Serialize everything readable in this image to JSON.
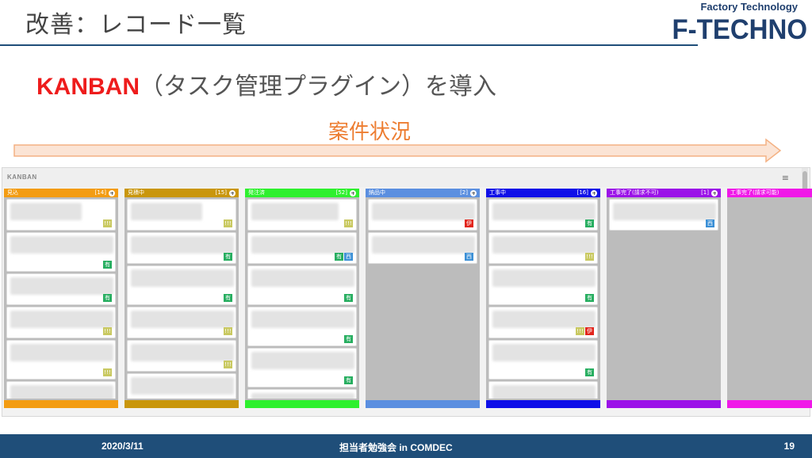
{
  "slide": {
    "title": "改善：レコード一覧",
    "logo_small": "Factory Technology",
    "logo_big": "F-TECHNO",
    "heading_accent": "KANBAN",
    "heading_rest": "（タスク管理プラグイン）を導入",
    "status_label": "案件状況",
    "arrow_color": "#f4b183"
  },
  "kanban": {
    "name": "KANBAN",
    "menu_icon": "hamburger-icon",
    "columns": [
      {
        "label": "見込",
        "count": "[14]",
        "color": "#f39c12",
        "cards": [
          {
            "h": 40,
            "blur": 90,
            "tags": [
              "y"
            ]
          },
          {
            "h": 50,
            "blur": 130,
            "tags": [
              "g"
            ]
          },
          {
            "h": 40,
            "blur": 130,
            "tags": [
              "g"
            ]
          },
          {
            "h": 40,
            "blur": 130,
            "tags": [
              "y"
            ]
          },
          {
            "h": 50,
            "blur": 130,
            "tags": [
              "y"
            ]
          },
          {
            "h": 40,
            "blur": 130,
            "tags": []
          }
        ]
      },
      {
        "label": "見積中",
        "count": "[15]",
        "color": "#c9960c",
        "cards": [
          {
            "h": 40,
            "blur": 90,
            "tags": [
              "y"
            ]
          },
          {
            "h": 40,
            "blur": 130,
            "tags": [
              "g"
            ]
          },
          {
            "h": 50,
            "blur": 130,
            "tags": [
              "g"
            ]
          },
          {
            "h": 40,
            "blur": 130,
            "tags": [
              "y"
            ]
          },
          {
            "h": 40,
            "blur": 130,
            "tags": [
              "y"
            ]
          },
          {
            "h": 40,
            "blur": 130,
            "tags": []
          }
        ]
      },
      {
        "label": "発注済",
        "count": "[52]",
        "color": "#2ef02e",
        "cards": [
          {
            "h": 40,
            "blur": 110,
            "tags": [
              "y"
            ]
          },
          {
            "h": 40,
            "blur": 130,
            "tags": [
              "g",
              "b"
            ]
          },
          {
            "h": 50,
            "blur": 130,
            "tags": [
              "g"
            ]
          },
          {
            "h": 50,
            "blur": 130,
            "tags": [
              "g"
            ]
          },
          {
            "h": 50,
            "blur": 130,
            "tags": [
              "g"
            ]
          },
          {
            "h": 40,
            "blur": 130,
            "tags": []
          }
        ]
      },
      {
        "label": "納品中",
        "count": "[2]",
        "color": "#5b8fe0",
        "cards": [
          {
            "h": 40,
            "blur": 130,
            "tags": [
              "r"
            ]
          },
          {
            "h": 40,
            "blur": 130,
            "tags": [
              "b"
            ]
          }
        ]
      },
      {
        "label": "工事中",
        "count": "[16]",
        "color": "#1010e8",
        "cards": [
          {
            "h": 40,
            "blur": 130,
            "tags": [
              "g"
            ]
          },
          {
            "h": 40,
            "blur": 130,
            "tags": [
              "y"
            ]
          },
          {
            "h": 50,
            "blur": 130,
            "tags": [
              "g"
            ]
          },
          {
            "h": 40,
            "blur": 130,
            "tags": [
              "y",
              "r"
            ]
          },
          {
            "h": 50,
            "blur": 130,
            "tags": [
              "g"
            ]
          },
          {
            "h": 40,
            "blur": 130,
            "tags": []
          }
        ]
      },
      {
        "label": "工事完了(請求不可)",
        "count": "[1]",
        "color": "#9b12e8",
        "cards": [
          {
            "h": 40,
            "blur": 130,
            "tags": [
              "b"
            ]
          }
        ]
      },
      {
        "label": "工事完了(請求可能)",
        "count": "",
        "color": "#f018e8",
        "cards": []
      }
    ],
    "tag_labels": {
      "y": "!!!",
      "g": "有",
      "b": "西",
      "r": "伊"
    }
  },
  "footer": {
    "date": "2020/3/11",
    "event": "担当者勉強会 in COMDEC",
    "page": "19"
  }
}
